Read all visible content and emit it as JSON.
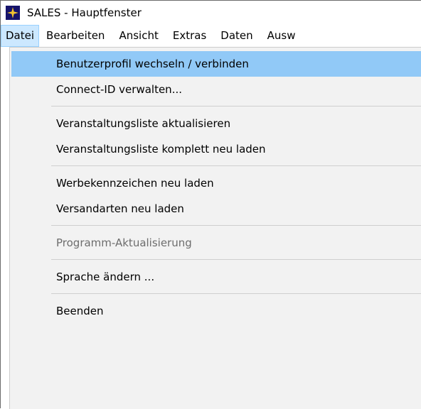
{
  "window": {
    "title": "SALES - Hauptfenster",
    "icon": "star-icon",
    "icon_color": "#16136b",
    "icon_star_color": "#f4c430"
  },
  "menubar": {
    "items": [
      {
        "label": "Datei",
        "active": true
      },
      {
        "label": "Bearbeiten"
      },
      {
        "label": "Ansicht"
      },
      {
        "label": "Extras"
      },
      {
        "label": "Daten"
      },
      {
        "label": "Ausw"
      }
    ]
  },
  "dropdown": {
    "items": [
      {
        "label": "Benutzerprofil wechseln / verbinden",
        "highlighted": true
      },
      {
        "label": "Connect-ID verwalten..."
      },
      {
        "label": "Veranstaltungsliste aktualisieren"
      },
      {
        "label": "Veranstaltungsliste komplett neu laden"
      },
      {
        "label": "Werbekennzeichen neu laden"
      },
      {
        "label": "Versandarten neu laden"
      },
      {
        "label": "Programm-Aktualisierung",
        "disabled": true
      },
      {
        "label": "Sprache ändern ..."
      },
      {
        "label": "Beenden"
      }
    ],
    "highlight_color": "#91c9f7",
    "background_color": "#f2f2f2"
  }
}
